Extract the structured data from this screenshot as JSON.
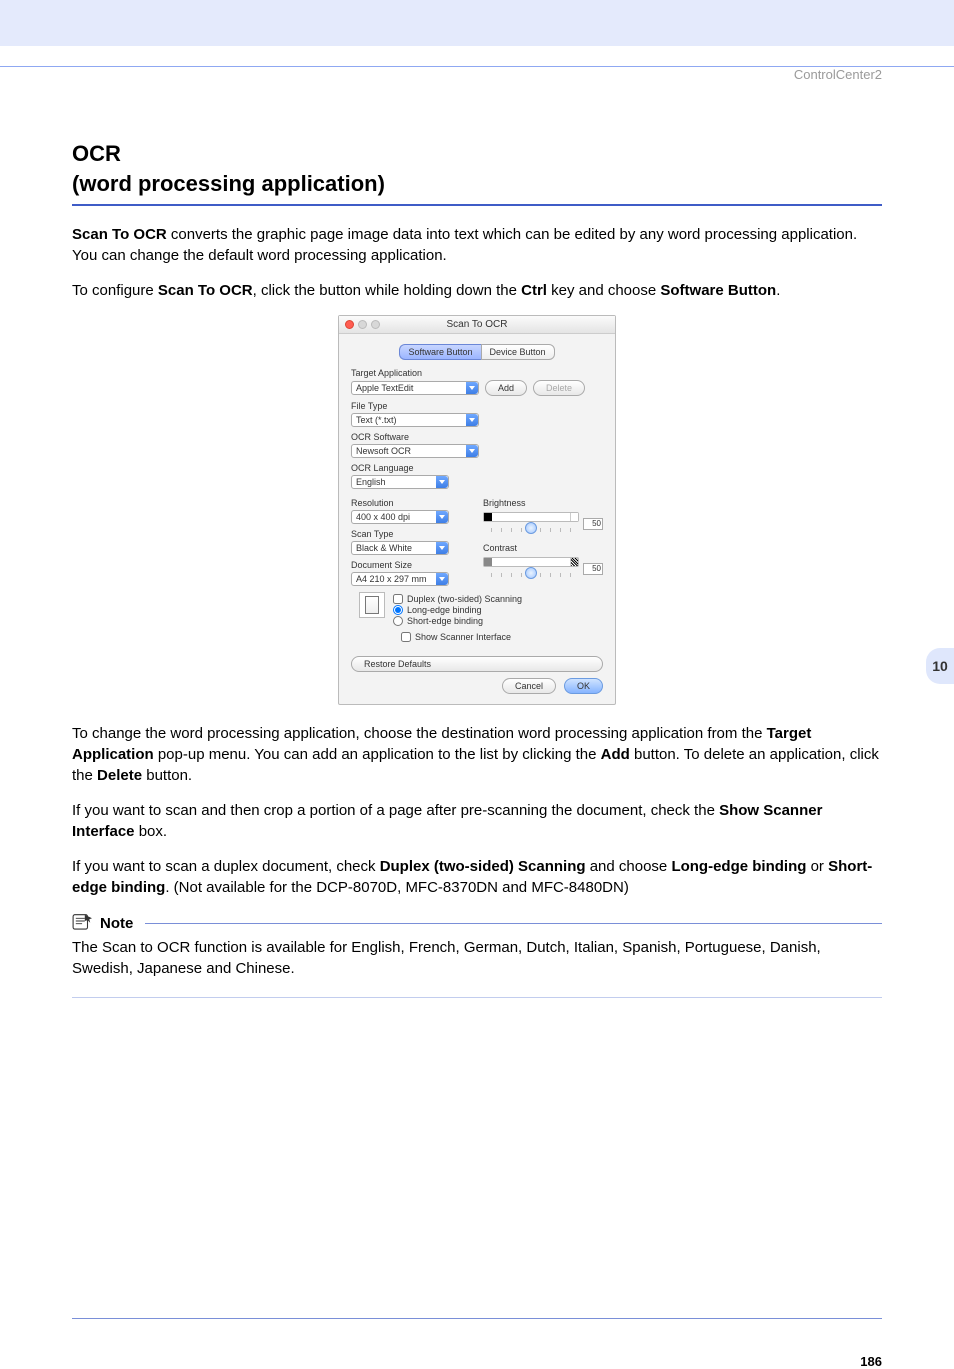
{
  "header": {
    "running": "ControlCenter2"
  },
  "h1_line1": "OCR",
  "h1_line2": "(word processing application)",
  "para1_lead": "Scan To OCR",
  "para1_rest": " converts the graphic page image data into text which can be edited by any word processing application. You can change the default word processing application.",
  "para2_a": "To configure ",
  "para2_b": "Scan To OCR",
  "para2_c": ", click the button while holding down the ",
  "para2_d": "Ctrl",
  "para2_e": " key and choose ",
  "para2_f": "Software Button",
  "para2_g": ".",
  "dialog": {
    "title": "Scan To OCR",
    "tabs": {
      "software": "Software Button",
      "device": "Device Button"
    },
    "labels": {
      "target": "Target Application",
      "filetype": "File Type",
      "ocrsw": "OCR Software",
      "ocrlang": "OCR Language",
      "resolution": "Resolution",
      "scantype": "Scan Type",
      "docsize": "Document Size",
      "brightness": "Brightness",
      "contrast": "Contrast",
      "duplex": "Duplex (two-sided) Scanning",
      "long": "Long-edge binding",
      "short": "Short-edge binding",
      "showscanner": "Show Scanner Interface",
      "restore": "Restore Defaults",
      "cancel": "Cancel",
      "ok": "OK",
      "add": "Add",
      "delete": "Delete"
    },
    "values": {
      "target": "Apple TextEdit",
      "filetype": "Text (*.txt)",
      "ocrsw": "Newsoft OCR",
      "ocrlang": "English",
      "resolution": "400 x 400 dpi",
      "scantype": "Black & White",
      "docsize": "A4  210 x 297 mm",
      "brightness": "50",
      "contrast": "50"
    }
  },
  "para3_a": "To change the word processing application, choose the destination word processing application from the ",
  "para3_b": "Target Application",
  "para3_c": " pop-up menu. You can add an application to the list by clicking the ",
  "para3_d": "Add",
  "para3_e": " button. To delete an application, click the ",
  "para3_f": "Delete",
  "para3_g": " button.",
  "para4_a": "If you want to scan and then crop a portion of a page after pre-scanning the document, check the ",
  "para4_b": "Show Scanner Interface",
  "para4_c": " box.",
  "para5_a": "If you want to scan a duplex document, check ",
  "para5_b": "Duplex (two-sided) Scanning",
  "para5_c": " and choose ",
  "para5_d": "Long-edge binding",
  "para5_e": " or ",
  "para5_f": "Short-edge binding",
  "para5_g": ". (Not available for the DCP-8070D, MFC-8370DN and MFC-8480DN)",
  "note": {
    "title": "Note",
    "body": "The Scan to OCR function is available for English, French, German, Dutch, Italian, Spanish, Portuguese, Danish, Swedish, Japanese and Chinese."
  },
  "chapter_tab": "10",
  "page_number": "186"
}
